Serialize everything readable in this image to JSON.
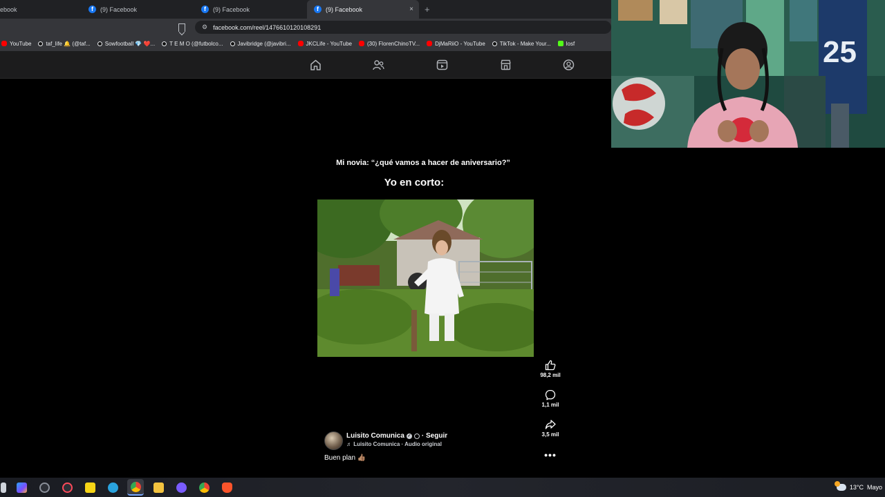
{
  "browser": {
    "tabs": [
      {
        "label": "ebook",
        "active": false
      },
      {
        "label": "(9) Facebook",
        "active": false
      },
      {
        "label": "(9) Facebook",
        "active": false
      },
      {
        "label": "(9) Facebook",
        "active": true
      }
    ],
    "new_tab": "+",
    "close_glyph": "×",
    "url": "facebook.com/reel/1476610120108291",
    "bookmarks": [
      {
        "label": "YouTube",
        "icon": "youtube-icon"
      },
      {
        "label": "taf_life 🔔 (@taf...",
        "icon": "tiktok-icon"
      },
      {
        "label": "Sowfootball 💎 ❤️...",
        "icon": "tiktok-icon"
      },
      {
        "label": "T E M O (@futbolco...",
        "icon": "tiktok-icon"
      },
      {
        "label": "Javibridge (@javibri...",
        "icon": "tiktok-icon"
      },
      {
        "label": "JKCLife - YouTube",
        "icon": "youtube-icon"
      },
      {
        "label": "(30) FlorenChinoTV...",
        "icon": "youtube-icon"
      },
      {
        "label": "DjMaRiiO - YouTube",
        "icon": "youtube-icon"
      },
      {
        "label": "TikTok - Make Your...",
        "icon": "tiktok-icon"
      },
      {
        "label": "losf",
        "icon": "kick-icon"
      }
    ]
  },
  "reel": {
    "caption_line1": "Mi novia: “¿qué vamos a hacer de aniversario?”",
    "caption_line2": "Yo en corto:",
    "likes": "98,2 mil",
    "comments": "1,1 mil",
    "shares": "3,5 mil",
    "more": "•••",
    "author": "Luisito Comunica",
    "follow": "· Seguir",
    "audio": "♬ Luisito Comunica · Audio original",
    "description": "Buen plan 👍🏽"
  },
  "taskbar": {
    "temperature": "13°C",
    "weather_text": "Mayo"
  },
  "colors": {
    "facebook_blue": "#1877f2",
    "page_background": "#000000",
    "browser_chrome": "#35363a"
  }
}
